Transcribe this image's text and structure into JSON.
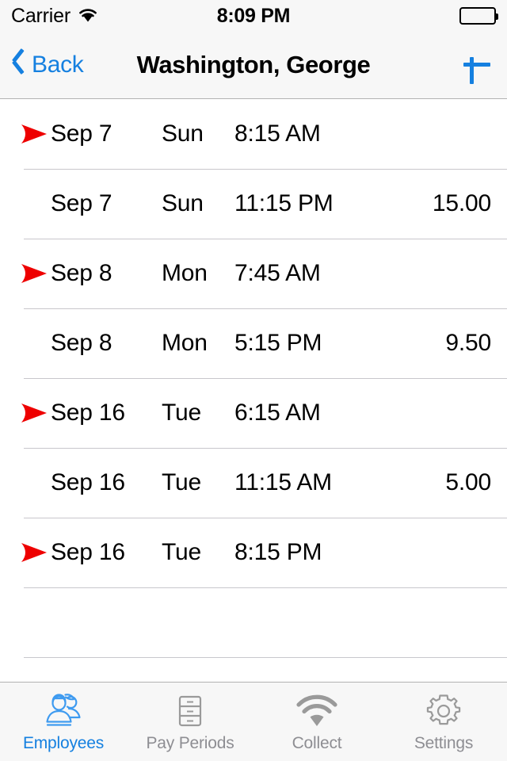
{
  "status_bar": {
    "carrier": "Carrier",
    "wifi_icon": "wifi-icon",
    "time": "8:09 PM",
    "battery_icon": "battery-full-icon"
  },
  "nav_bar": {
    "back_icon": "chevron-left-icon",
    "back_label": "Back",
    "title": "Washington, George",
    "add_icon": "plus-icon"
  },
  "colors": {
    "accent": "#1580e0",
    "marker": "#ee0000",
    "inactive_tab": "#8e8e93",
    "separator": "#c8c7cc",
    "bar_background": "#f7f7f7"
  },
  "time_entries": {
    "columns": [
      "marker",
      "date",
      "day",
      "time",
      "amount"
    ],
    "rows": [
      {
        "marker": "clock-in-arrow-icon",
        "date": "Sep 7",
        "day": "Sun",
        "time": "8:15 AM",
        "amount": ""
      },
      {
        "marker": "",
        "date": "Sep 7",
        "day": "Sun",
        "time": "11:15 PM",
        "amount": "15.00"
      },
      {
        "marker": "clock-in-arrow-icon",
        "date": "Sep 8",
        "day": "Mon",
        "time": "7:45 AM",
        "amount": ""
      },
      {
        "marker": "",
        "date": "Sep 8",
        "day": "Mon",
        "time": "5:15 PM",
        "amount": "9.50"
      },
      {
        "marker": "clock-in-arrow-icon",
        "date": "Sep 16",
        "day": "Tue",
        "time": "6:15 AM",
        "amount": ""
      },
      {
        "marker": "",
        "date": "Sep 16",
        "day": "Tue",
        "time": "11:15 AM",
        "amount": "5.00"
      },
      {
        "marker": "clock-in-arrow-icon",
        "date": "Sep 16",
        "day": "Tue",
        "time": "8:15 PM",
        "amount": ""
      },
      {
        "marker": "",
        "date": "",
        "day": "",
        "time": "",
        "amount": ""
      },
      {
        "marker": "",
        "date": "",
        "day": "",
        "time": "",
        "amount": ""
      }
    ]
  },
  "tab_bar": {
    "tabs": [
      {
        "label": "Employees",
        "icon": "employees-icon",
        "active": true
      },
      {
        "label": "Pay Periods",
        "icon": "file-cabinet-icon",
        "active": false
      },
      {
        "label": "Collect",
        "icon": "wifi-icon",
        "active": false
      },
      {
        "label": "Settings",
        "icon": "gear-icon",
        "active": false
      }
    ]
  }
}
